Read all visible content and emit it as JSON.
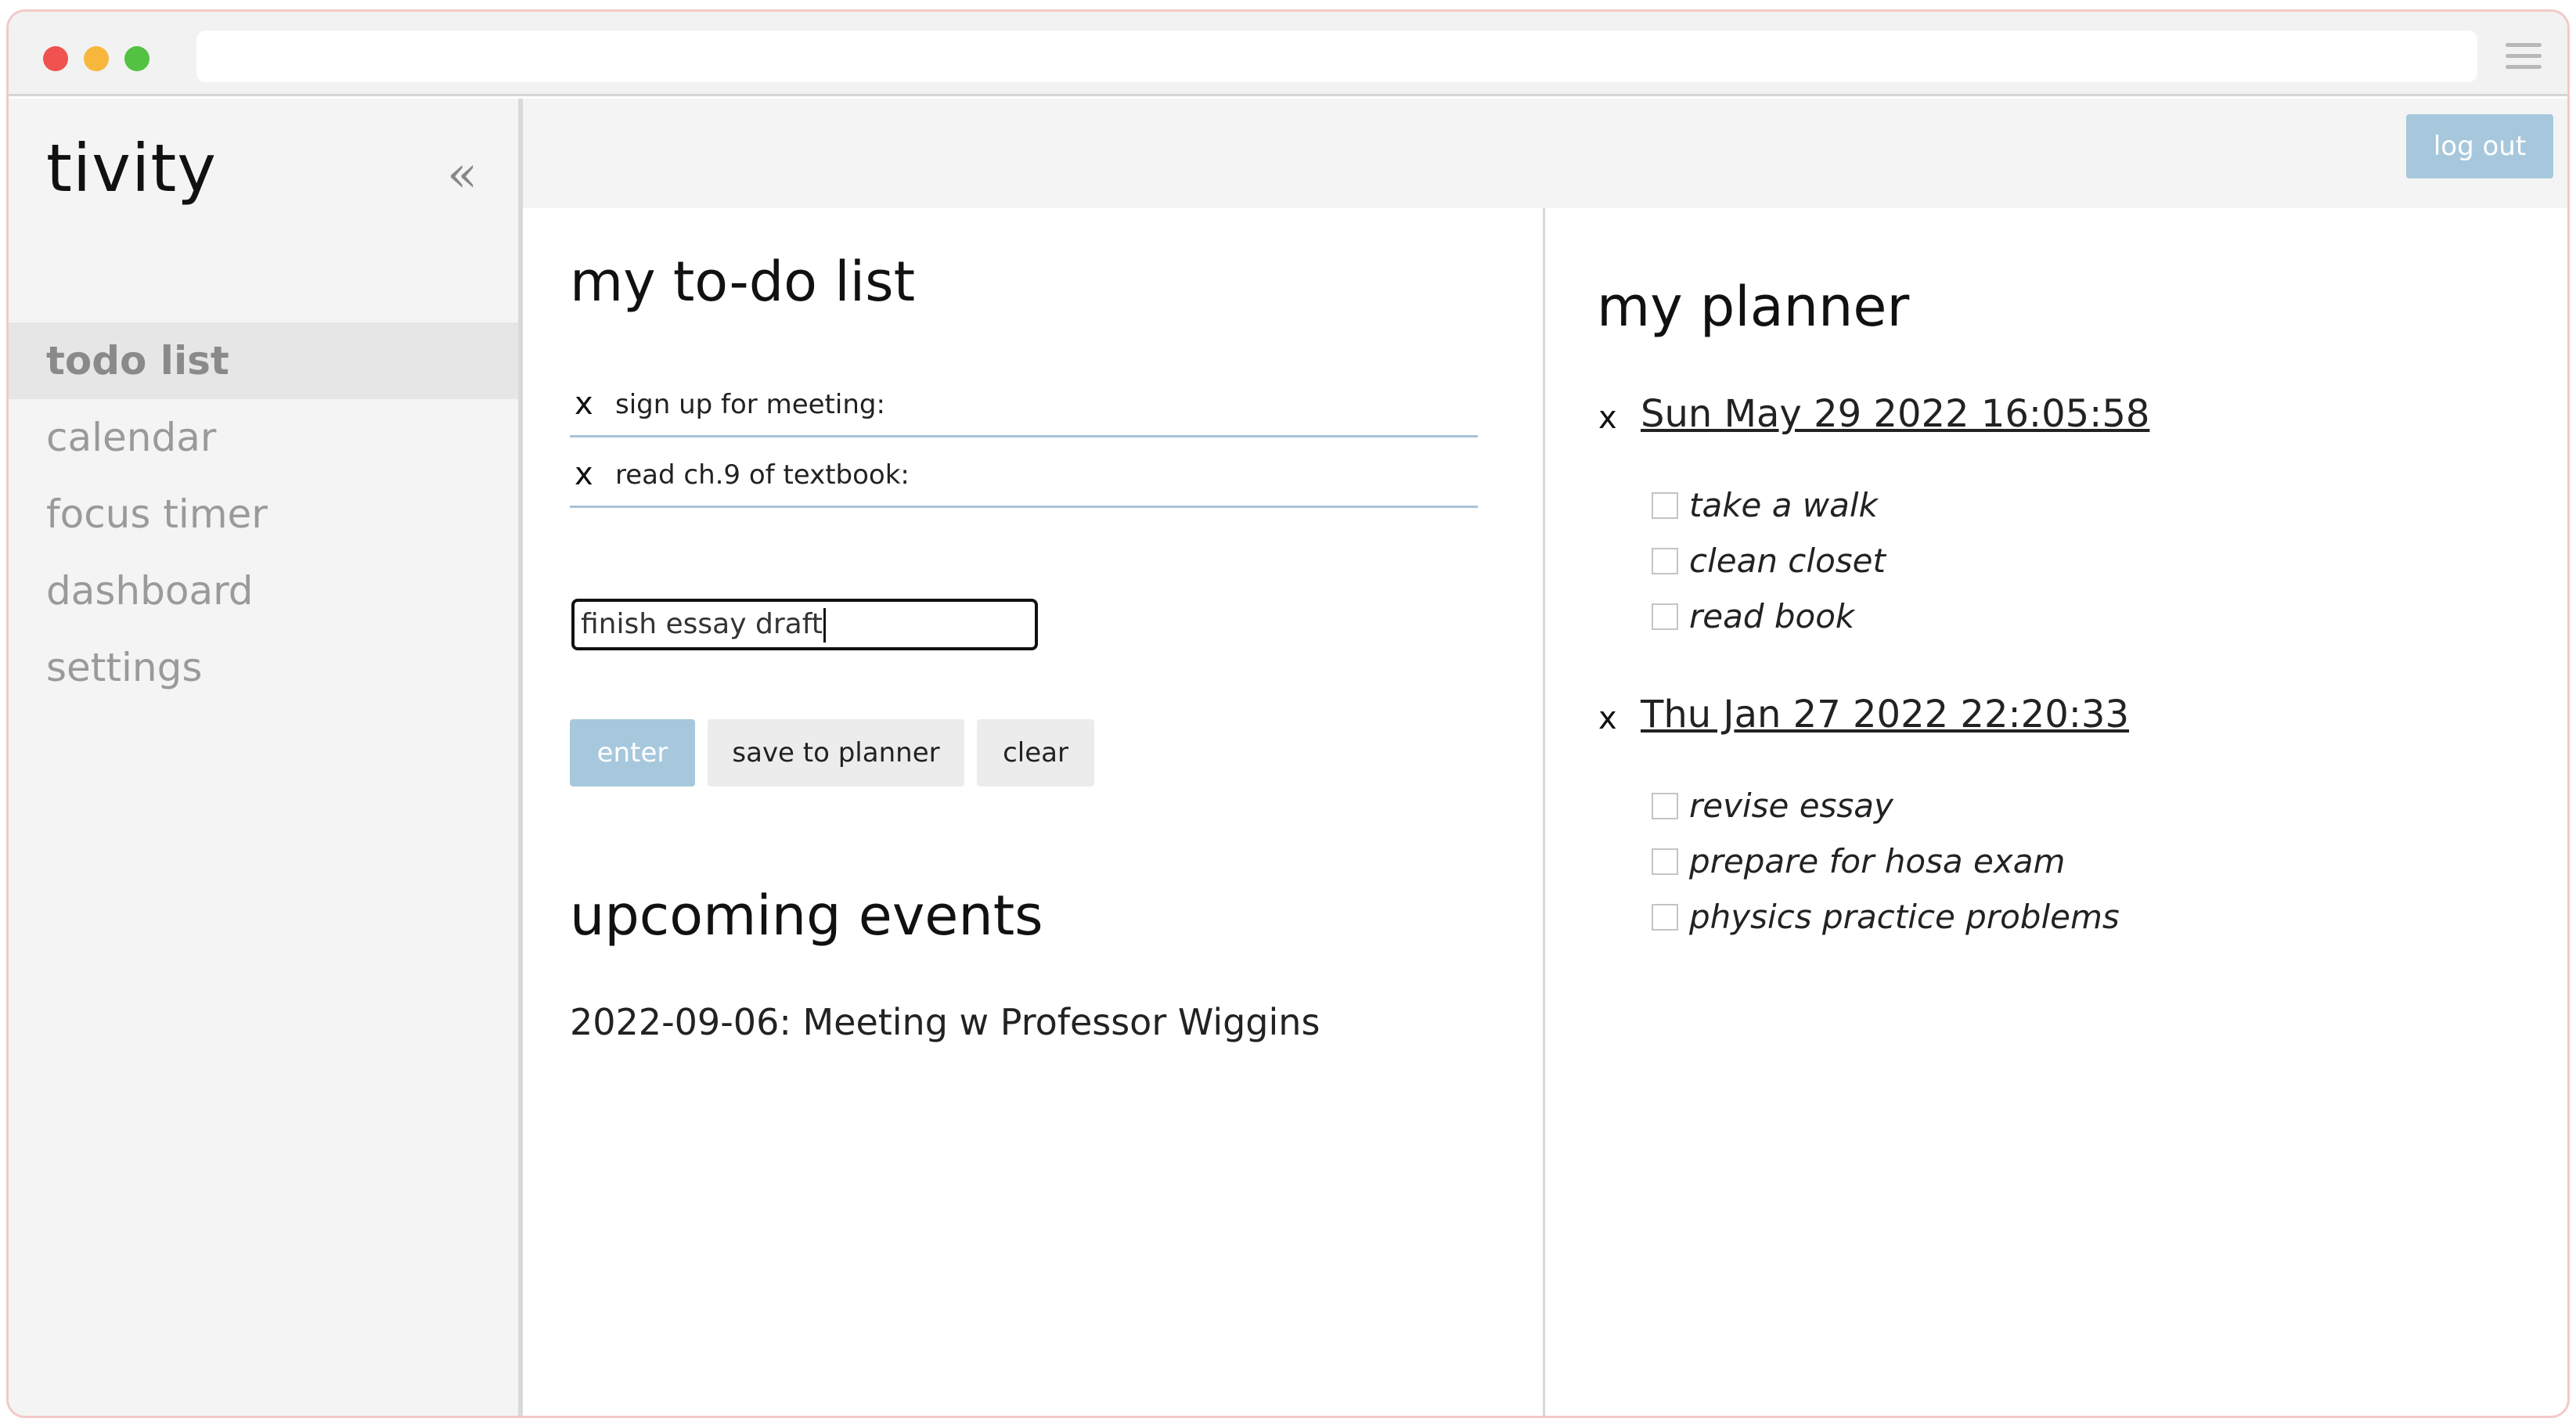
{
  "app": {
    "brand": "tivity",
    "collapse_glyph": "«"
  },
  "sidebar": {
    "items": [
      {
        "label": "todo list",
        "active": true
      },
      {
        "label": "calendar"
      },
      {
        "label": "focus timer"
      },
      {
        "label": "dashboard"
      },
      {
        "label": "settings"
      }
    ]
  },
  "header": {
    "logout_label": "log out"
  },
  "todo": {
    "title": "my to-do list",
    "remove_glyph": "x",
    "items": [
      {
        "text": "sign up for meeting:"
      },
      {
        "text": "read ch.9 of textbook:"
      }
    ],
    "input_value": "finish essay draft",
    "buttons": {
      "enter": "enter",
      "save": "save to planner",
      "clear": "clear"
    }
  },
  "events": {
    "title": "upcoming events",
    "items": [
      {
        "text": "2022-09-06: Meeting w Professor Wiggins"
      }
    ]
  },
  "planner": {
    "title": "my planner",
    "remove_glyph": "x",
    "groups": [
      {
        "date": "Sun May 29 2022 16:05:58",
        "tasks": [
          "take a walk",
          "clean closet",
          "read book"
        ]
      },
      {
        "date": "Thu Jan 27 2022 22:20:33",
        "tasks": [
          "revise essay",
          "prepare for hosa exam",
          "physics practice problems"
        ]
      }
    ]
  },
  "colors": {
    "accent": "#a7c8dc",
    "window_border": "#f4c9c9",
    "sidebar_bg": "#f4f4f4"
  }
}
